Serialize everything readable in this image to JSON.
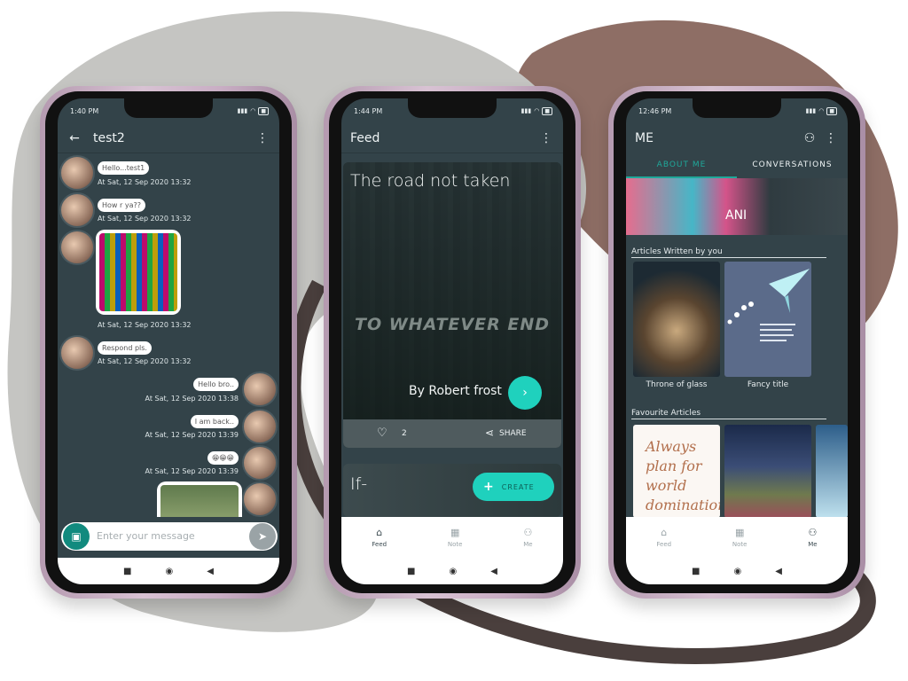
{
  "colors": {
    "accent": "#1fd1bd",
    "screen_bg": "#334349",
    "tab_active": "#1fa89a",
    "frame": "#c9aec4"
  },
  "chat": {
    "time": "1:40 PM",
    "title": "test2",
    "messages": [
      {
        "from": "them",
        "text": "Hello...test1",
        "stamp": "At Sat, 12 Sep 2020 13:32"
      },
      {
        "from": "them",
        "text": "How r ya??",
        "stamp": "At Sat, 12 Sep 2020 13:32"
      },
      {
        "from": "them",
        "type": "image",
        "stamp": "At Sat, 12 Sep 2020 13:32"
      },
      {
        "from": "them",
        "text": "Respond pls.",
        "stamp": "At Sat, 12 Sep 2020 13:32"
      },
      {
        "from": "me",
        "text": "Hello bro..",
        "stamp": "At Sat, 12 Sep 2020 13:38"
      },
      {
        "from": "me",
        "text": "I am back..",
        "stamp": "At Sat, 12 Sep 2020 13:39"
      },
      {
        "from": "me",
        "text": "😁😁😁",
        "stamp": "At Sat, 12 Sep 2020 13:39"
      }
    ],
    "input_placeholder": "Enter your message"
  },
  "feed": {
    "time": "1:44 PM",
    "title": "Feed",
    "card": {
      "title": "The road not taken",
      "quote": "TO WHATEVER END",
      "author": "By Robert frost",
      "likes": "2",
      "share": "SHARE"
    },
    "second_card_title": "If-",
    "create_label": "CREATE",
    "nav": [
      {
        "label": "Feed",
        "icon": "home-icon"
      },
      {
        "label": "Note",
        "icon": "dashboard-icon"
      },
      {
        "label": "Me",
        "icon": "person-icon"
      }
    ]
  },
  "me": {
    "time": "12:46 PM",
    "title": "ME",
    "tabs": [
      "ABOUT ME",
      "CONVERSATIONS"
    ],
    "profile_name": "ANI",
    "articles_label": "Articles Written by you",
    "articles": [
      "Throne of glass",
      "Fancy title"
    ],
    "favourites_label": "Favourite Articles",
    "fav_quote": "Always plan for world domination",
    "nav": [
      {
        "label": "Feed",
        "icon": "home-icon"
      },
      {
        "label": "Note",
        "icon": "dashboard-icon"
      },
      {
        "label": "Me",
        "icon": "person-icon"
      }
    ]
  }
}
